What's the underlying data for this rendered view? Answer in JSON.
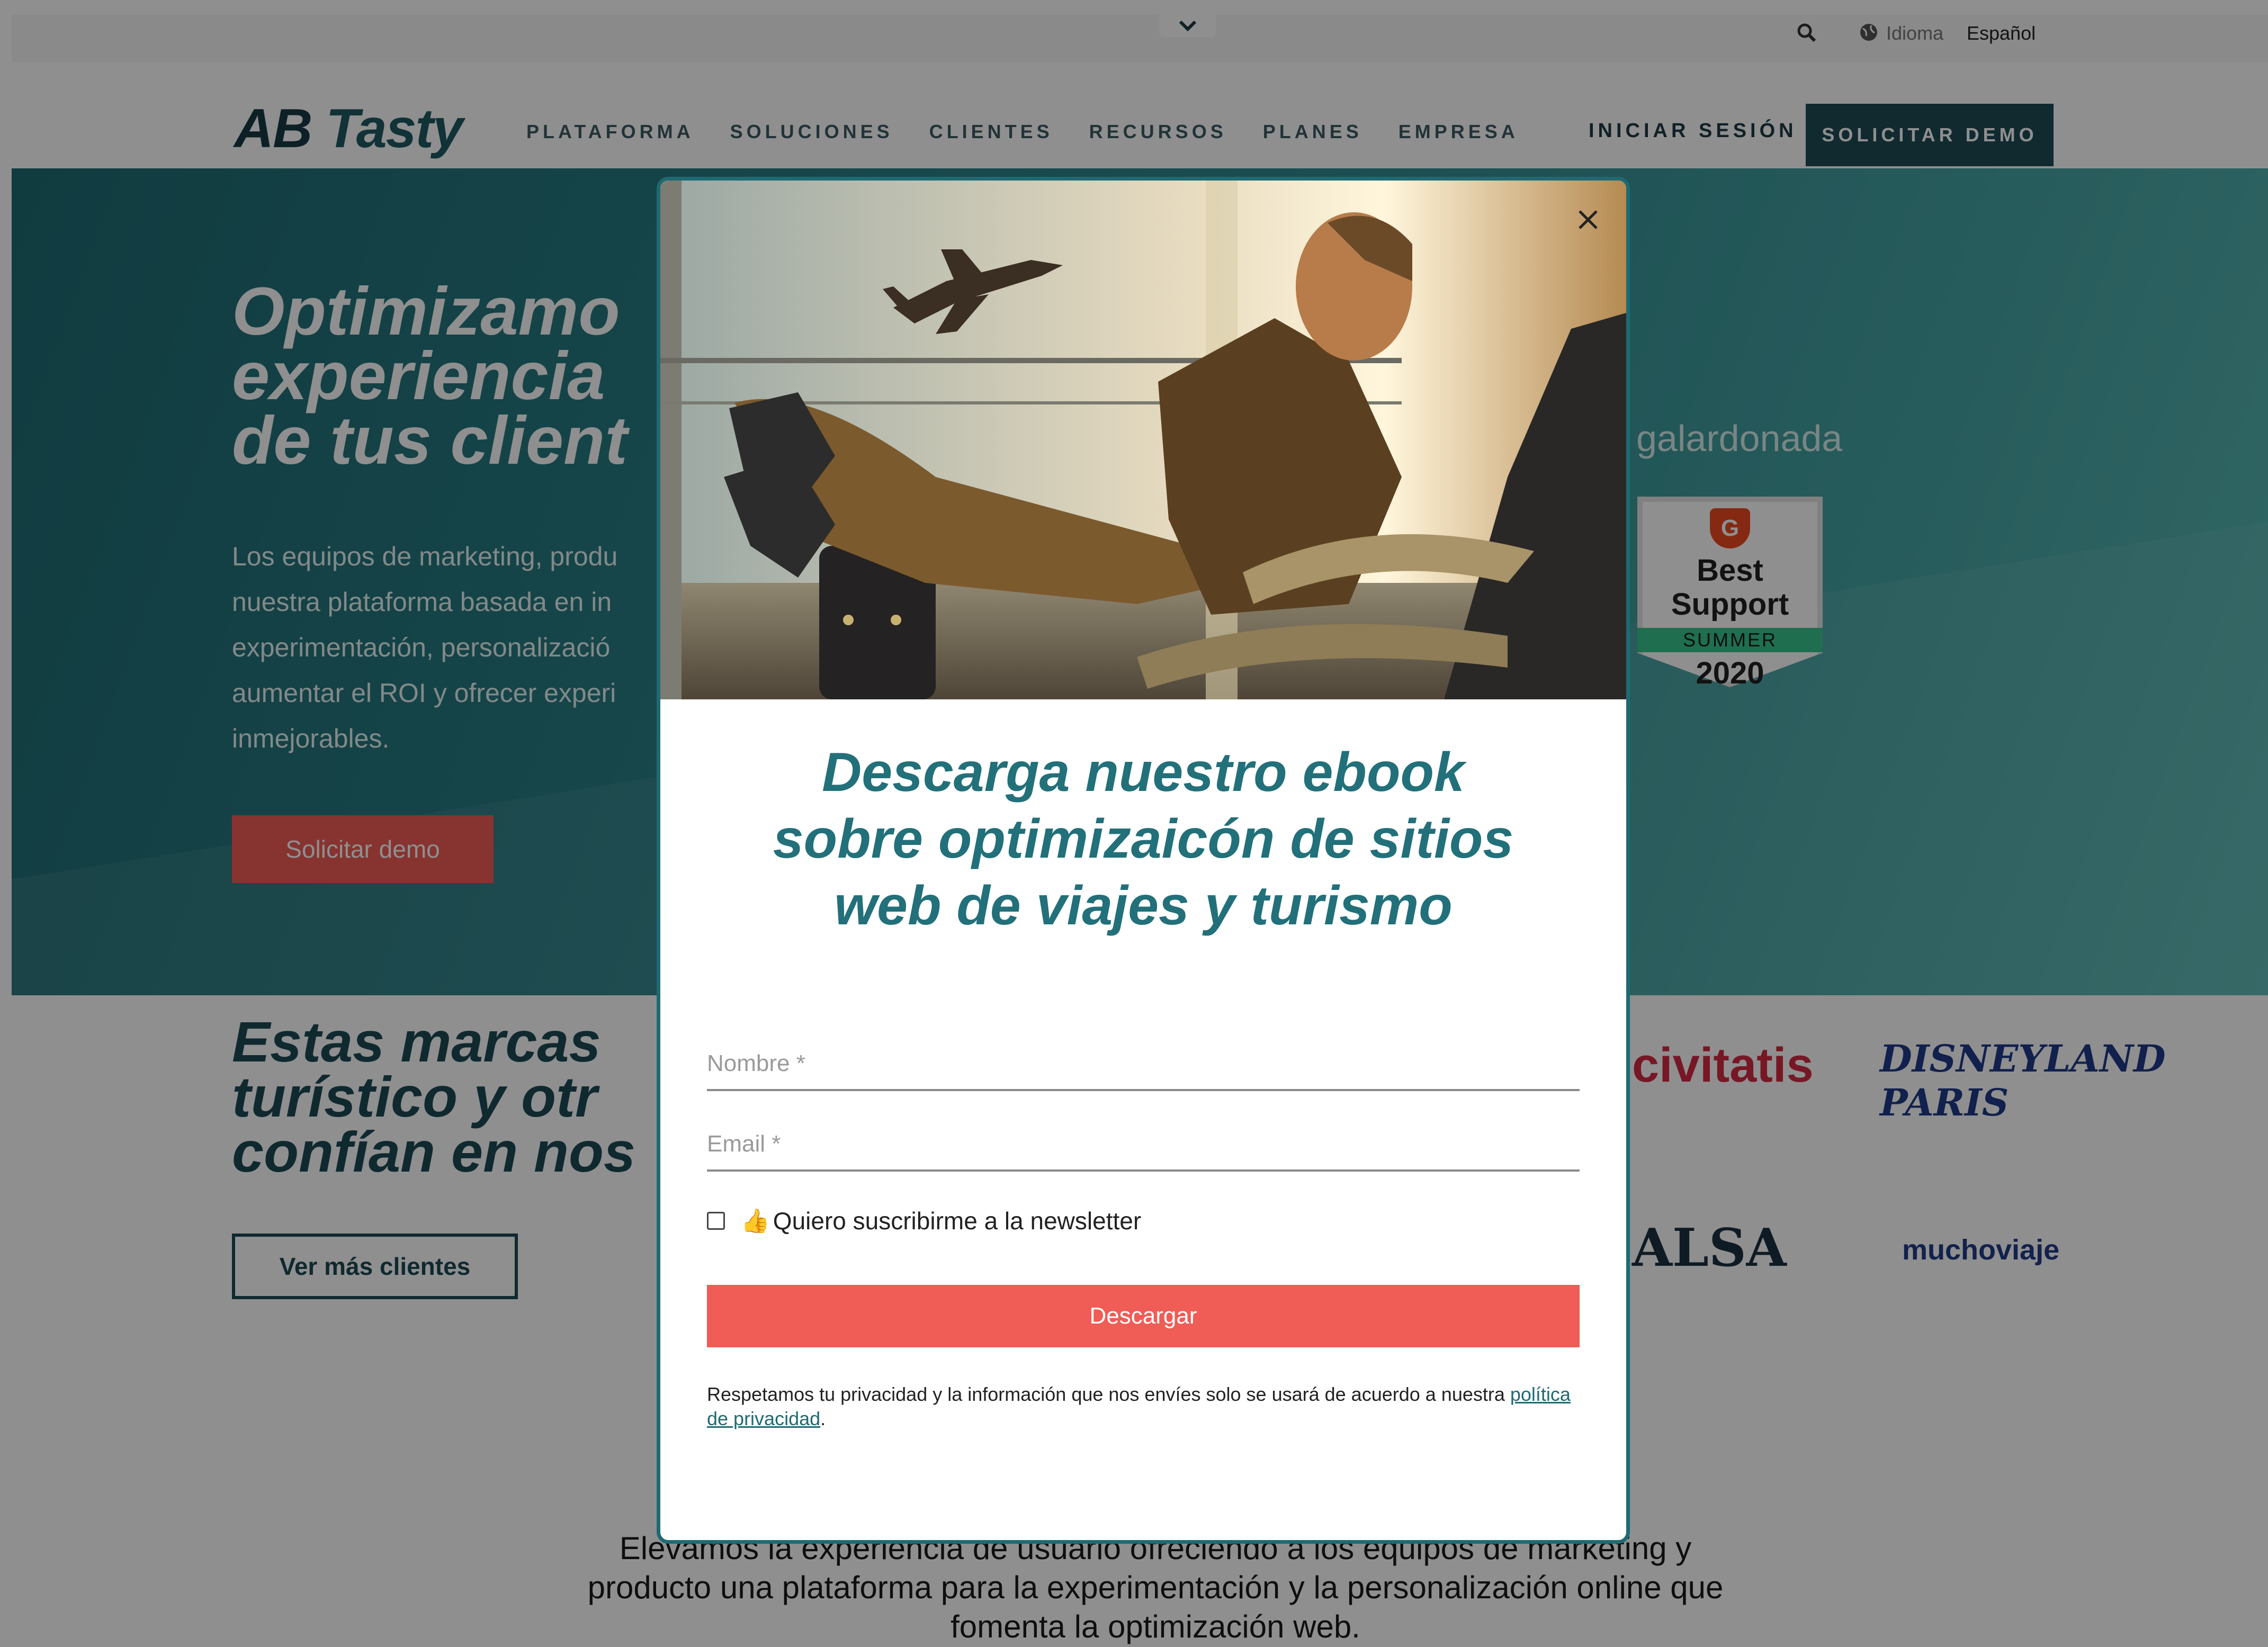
{
  "utility": {
    "lang_label": "Idioma",
    "lang_value": "Español"
  },
  "nav": {
    "logo_ab": "AB",
    "logo_tasty": "Tasty",
    "links": [
      "PLATAFORMA",
      "SOLUCIONES",
      "CLIENTES",
      "RECURSOS",
      "PLANES",
      "EMPRESA"
    ],
    "login": "INICIAR SESIÓN",
    "demo": "SOLICITAR DEMO"
  },
  "hero": {
    "title": "Optimizamo\nexperiencia\nde tus client",
    "text": "Los equipos de marketing, produ\nnuestra plataforma basada en in\nexperimentación, personalizació\naumentar el ROI y ofrecer experi\ninmejorables.",
    "button": "Solicitar demo",
    "award": "galardonada",
    "badge_line1": "Best\nSupport",
    "badge_season": "SUMMER",
    "badge_year": "2020"
  },
  "brands": {
    "title": "Estas marcas\nturístico y otr\nconfían en nos",
    "button": "Ver más clientes",
    "logos": [
      "civitatis",
      "DISNEYLAND PARIS",
      "ALSA",
      "muchoviaje"
    ]
  },
  "bottom": {
    "text": "Elevamos la experiencia de usuario ofreciendo a los equipos de marketing y\nproducto una plataforma para la experimentación y la personalización online que\nfomenta la optimización web."
  },
  "modal": {
    "title": "Descarga nuestro ebook\nsobre optimizaicón de sitios\nweb de viajes y turismo",
    "name_placeholder": "Nombre *",
    "email_placeholder": "Email *",
    "newsletter_label": "Quiero suscribirme a la newsletter",
    "newsletter_checked": false,
    "submit": "Descargar",
    "privacy_text": "Respetamos tu privacidad y la información que nos envíes solo se usará de acuerdo a nuestra",
    "privacy_link": "política de privacidad",
    "privacy_end": "."
  },
  "colors": {
    "brand_teal": "#1f6a72",
    "cta_red": "#f05c56",
    "dark_navy": "#1d4c57"
  }
}
